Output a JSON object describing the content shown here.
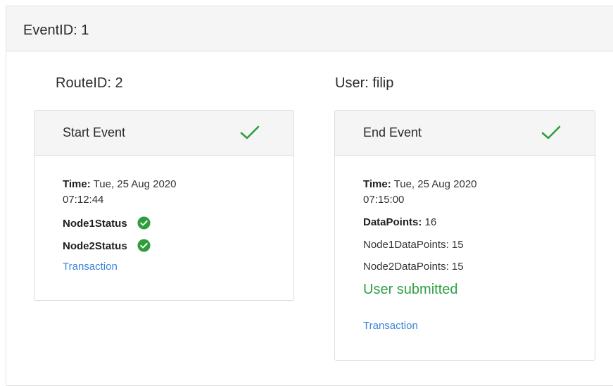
{
  "event": {
    "label": "EventID: 1"
  },
  "route": {
    "label": "RouteID: 2"
  },
  "user": {
    "label": "User: filip"
  },
  "start_event": {
    "title": "Start Event",
    "time_label": "Time:",
    "time_line1": "Tue, 25 Aug 2020",
    "time_line2": "07:12:44",
    "node1_status_label": "Node1Status",
    "node2_status_label": "Node2Status",
    "transaction_link": "Transaction"
  },
  "end_event": {
    "title": "End Event",
    "time_label": "Time:",
    "time_line1": "Tue, 25 Aug 2020",
    "time_line2": "07:15:00",
    "datapoints_label": "DataPoints:",
    "datapoints_value": "16",
    "node1_datapoints": "Node1DataPoints: 15",
    "node2_datapoints": "Node2DataPoints: 15",
    "status_text": "User submitted",
    "transaction_link": "Transaction"
  },
  "colors": {
    "success_green": "#2ea043",
    "check_green": "#2e9e3c",
    "link_blue": "#3a86d9",
    "header_gray": "#f5f5f5"
  },
  "icons": {
    "card_check": "checkmark-icon",
    "status_ok": "check-circle-icon"
  }
}
